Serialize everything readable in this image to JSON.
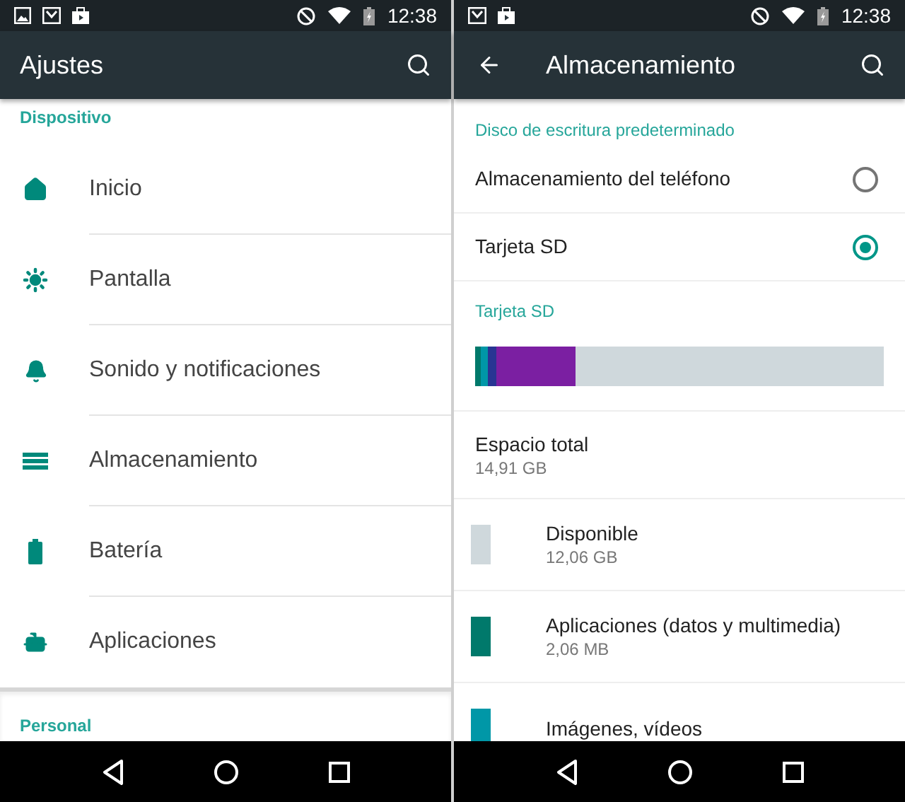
{
  "screens": [
    {
      "kind": "settings",
      "status_bar": {
        "notifications": [
          {
            "kind": "image"
          },
          {
            "kind": "mail"
          },
          {
            "kind": "bag"
          }
        ],
        "time": "12:38"
      },
      "toolbar": {
        "title": "Ajustes",
        "back": false
      },
      "sections": [
        {
          "header": "Dispositivo",
          "items": [
            {
              "label": "Inicio",
              "kind": "home"
            },
            {
              "label": "Pantalla",
              "kind": "brightness"
            },
            {
              "label": "Sonido y notificaciones",
              "kind": "bell"
            },
            {
              "label": "Almacenamiento",
              "kind": "storage"
            },
            {
              "label": "Batería",
              "kind": "battery"
            },
            {
              "label": "Aplicaciones",
              "kind": "android"
            }
          ]
        },
        {
          "header": "Personal"
        }
      ]
    },
    {
      "kind": "storage",
      "status_bar": {
        "notifications": [
          {
            "kind": "mail"
          },
          {
            "kind": "bag"
          }
        ],
        "time": "12:38"
      },
      "toolbar": {
        "title": "Almacenamiento",
        "back": true
      },
      "default_disk": {
        "header": "Disco de escritura predeterminado",
        "options": [
          {
            "label": "Almacenamiento del teléfono",
            "selected": false
          },
          {
            "label": "Tarjeta SD",
            "selected": true
          }
        ]
      },
      "card": {
        "header": "Tarjeta SD",
        "segments": [
          {
            "color": "#00796b",
            "level": 0.014
          },
          {
            "color": "#0097a7",
            "level": 0.017
          },
          {
            "color": "#283593",
            "level": 0.02
          },
          {
            "color": "#7b1fa2",
            "level": 0.195
          }
        ],
        "total": {
          "label": "Espacio total",
          "value": "14,91 GB"
        },
        "items": [
          {
            "label": "Disponible",
            "value": "12,06 GB",
            "color": "#cfd8dc"
          },
          {
            "label": "Aplicaciones (datos y multimedia)",
            "value": "2,06 MB",
            "color": "#00796b"
          },
          {
            "label": "Imágenes, vídeos",
            "color": "#0097a7"
          }
        ]
      }
    }
  ]
}
